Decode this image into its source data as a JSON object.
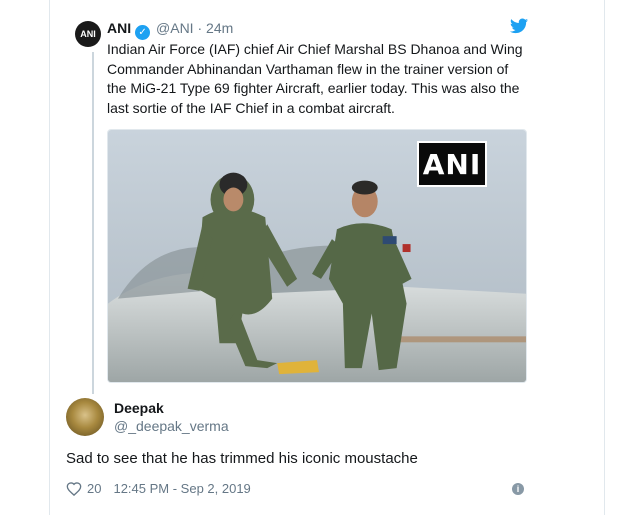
{
  "quoted_tweet": {
    "avatar_label": "ANI",
    "name": "ANI",
    "handle": "@ANI",
    "separator": "·",
    "time": "24m",
    "text": "Indian Air Force (IAF) chief Air Chief Marshal BS Dhanoa and Wing Commander Abhinandan Varthaman flew in the trainer version of the MiG-21 Type 69 fighter Aircraft, earlier today. This was also the last sortie of the IAF Chief in a combat aircraft.",
    "watermark": "ANI",
    "icons": [
      "verified-badge-icon",
      "twitter-bird-icon"
    ],
    "accent_color": "#1da1f2"
  },
  "reply": {
    "name": "Deepak",
    "handle": "@_deepak_verma",
    "text": "Sad to see that he has trimmed his iconic moustache",
    "likes": "20",
    "timestamp": "12:45 PM - Sep 2, 2019",
    "icons": [
      "heart-icon",
      "info-icon"
    ]
  }
}
